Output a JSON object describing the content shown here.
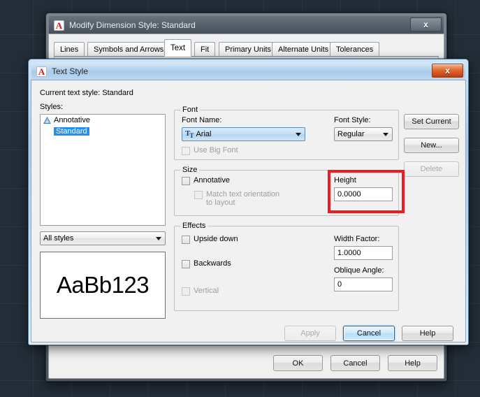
{
  "desktop": {
    "background_color": "#222d38",
    "grid_color": "#3a4450"
  },
  "dim_dialog": {
    "title": "Modify Dimension Style: Standard",
    "logo_icon": "autocad-a-icon",
    "close_icon": "x",
    "tabs": [
      {
        "label": "Lines",
        "active": false
      },
      {
        "label": "Symbols and Arrows",
        "active": false
      },
      {
        "label": "Text",
        "active": true
      },
      {
        "label": "Fit",
        "active": false
      },
      {
        "label": "Primary Units",
        "active": false
      },
      {
        "label": "Alternate Units",
        "active": false
      },
      {
        "label": "Tolerances",
        "active": false
      }
    ],
    "buttons": {
      "ok": "OK",
      "cancel": "Cancel",
      "help": "Help"
    }
  },
  "text_dialog": {
    "title": "Text Style",
    "logo_icon": "autocad-a-icon",
    "close_icon": "x",
    "current_style_label": "Current text style:  Standard",
    "styles_label": "Styles:",
    "styles_list": [
      {
        "label": "Annotative",
        "icon": "annotative-icon",
        "selected": false
      },
      {
        "label": "Standard",
        "icon": "",
        "selected": true
      }
    ],
    "filter": {
      "value": "All styles",
      "arrow_icon": "chevron-down-icon"
    },
    "preview_text": "AaBb123",
    "font_group": {
      "title": "Font",
      "font_name_label": "Font Name:",
      "font_name_value": "Arial",
      "font_name_icon": "truetype-icon",
      "font_style_label": "Font Style:",
      "font_style_value": "Regular",
      "use_big_font_label": "Use Big Font",
      "use_big_font_checked": false,
      "use_big_font_enabled": false
    },
    "size_group": {
      "title": "Size",
      "annotative_label": "Annotative",
      "annotative_checked": false,
      "match_orientation_label_line1": "Match text orientation",
      "match_orientation_label_line2": "to layout",
      "match_orientation_enabled": false,
      "height_label": "Height",
      "height_value": "0.0000",
      "highlight_color": "#ed1c24"
    },
    "effects_group": {
      "title": "Effects",
      "upside_down_label": "Upside down",
      "upside_down_checked": false,
      "backwards_label": "Backwards",
      "backwards_checked": false,
      "vertical_label": "Vertical",
      "vertical_enabled": false,
      "width_factor_label": "Width Factor:",
      "width_factor_value": "1.0000",
      "oblique_angle_label": "Oblique Angle:",
      "oblique_angle_value": "0"
    },
    "side_buttons": {
      "set_current": "Set Current",
      "new": "New...",
      "delete": "Delete",
      "delete_enabled": false
    },
    "footer_buttons": {
      "apply": "Apply",
      "apply_enabled": false,
      "cancel": "Cancel",
      "help": "Help"
    }
  }
}
